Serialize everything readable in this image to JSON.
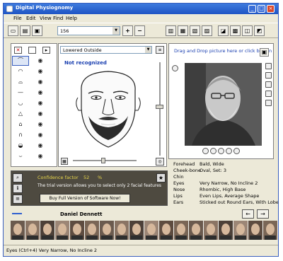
{
  "window": {
    "title": "Digital Physiognomy"
  },
  "menu": [
    "File",
    "Edit",
    "View",
    "Find",
    "Help"
  ],
  "toolbar": {
    "combo_value": "156"
  },
  "editor": {
    "shape_combo": "Lowered Outside",
    "status": "Not recognized"
  },
  "photo_panel": {
    "hint": "Drag and Drop picture here or click button"
  },
  "traits": [
    {
      "key": "Forehead",
      "value": "Bald, Wide"
    },
    {
      "key": "Cheek-bone",
      "value": "Oval, Set: 3"
    },
    {
      "key": "Chin",
      "value": ""
    },
    {
      "key": "Eyes",
      "value": "Very Narrow, No Incline 2"
    },
    {
      "key": "Nose",
      "value": "Rhombic, High Base"
    },
    {
      "key": "Lips",
      "value": "Even Lips, Average Shape"
    },
    {
      "key": "Ears",
      "value": "Sticked out Round Ears, With Lobe"
    }
  ],
  "info": {
    "confidence_label": "Confidence factor",
    "confidence_value": "52",
    "confidence_unit": "%",
    "trial_text": "The trial version allows you to select only 2 facial features",
    "buy_button": "Buy Full Version of Software Now!"
  },
  "person_name": "Daniel Dennett",
  "thumbnail_count": 18,
  "statusbar": "Eyes (Ctrl+4) Very Narrow, No Incline 2",
  "colors": {
    "accent": "#1a3fb0",
    "titlebar": "#2a62d0",
    "confidence": "#e8d64a"
  }
}
